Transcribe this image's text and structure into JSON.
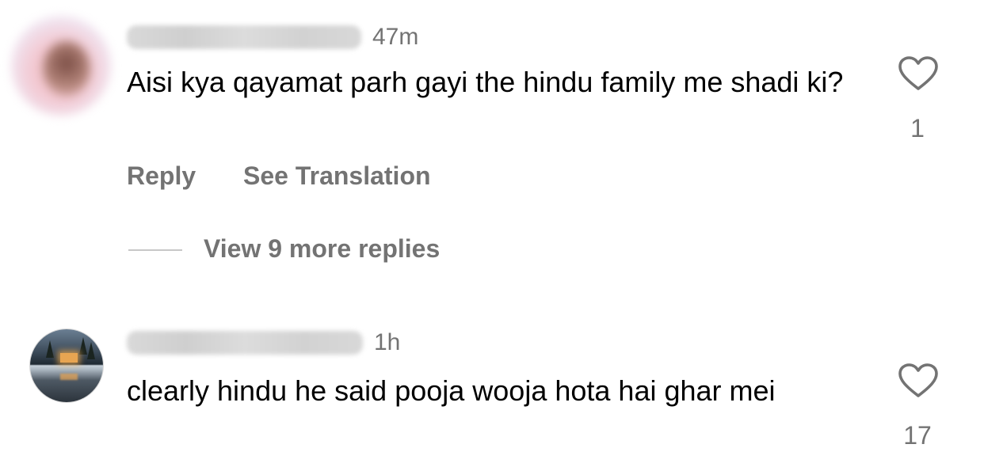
{
  "comments": [
    {
      "username_hidden": "",
      "time": "47m",
      "text": "Aisi kya qayamat parh gayi the hindu family me shadi ki?",
      "like_count": "1",
      "reply_label": "Reply",
      "translation_label": "See Translation",
      "view_replies_label": "View 9 more replies"
    },
    {
      "username_hidden": "",
      "time": "1h",
      "text": "clearly hindu he said pooja wooja hota hai ghar mei",
      "like_count": "17"
    }
  ],
  "icons": {
    "like": "heart-outline-icon"
  },
  "colors": {
    "secondary_text": "#737373",
    "primary_text": "#000000",
    "divider": "#c7c7c7"
  }
}
